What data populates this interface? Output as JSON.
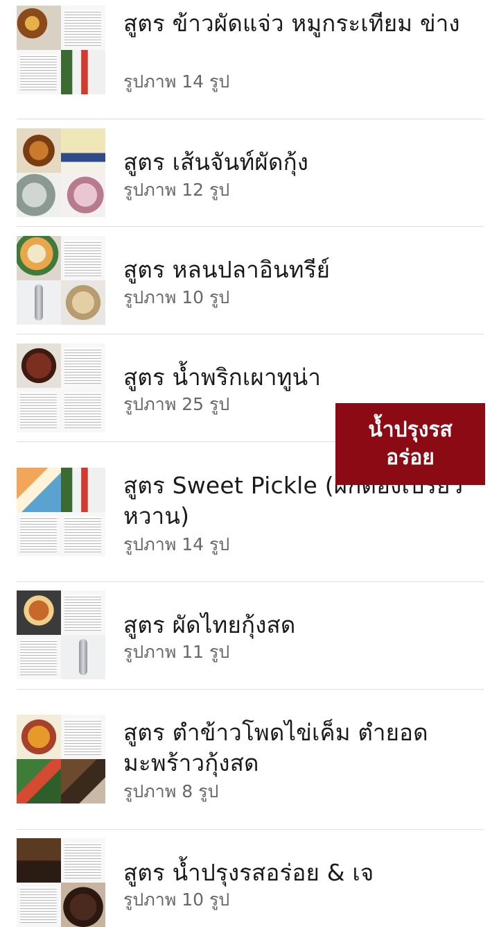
{
  "albums": [
    {
      "title": "สูตร ข้าวผัดแจ่ว หมูกระเทียม ข่าง",
      "count": "รูปภาพ 14 รูป"
    },
    {
      "title": "สูตร เส้นจันท์ผัดกุ้ง",
      "count": "รูปภาพ 12 รูป"
    },
    {
      "title": "สูตร หลนปลาอินทรีย์",
      "count": "รูปภาพ 10 รูป"
    },
    {
      "title": "สูตร น้ำพริกเผาทูน่า",
      "count": "รูปภาพ 25 รูป"
    },
    {
      "title": "สูตร Sweet Pickle (ผักดองเปรี้ยวหวาน)",
      "count": "รูปภาพ 14 รูป"
    },
    {
      "title": "สูตร ผัดไทยกุ้งสด",
      "count": "รูปภาพ 11 รูป"
    },
    {
      "title": "สูตร ตำข้าวโพดไข่เค็ม ตำยอดมะพร้าวกุ้งสด",
      "count": "รูปภาพ 8 รูป"
    },
    {
      "title": "สูตร น้ำปรุงรสอร่อย & เจ",
      "count": "รูปภาพ 10 รูป"
    }
  ],
  "overlay": {
    "text": "น้ำปรุงรส อร่อย"
  },
  "colors": {
    "overlay_bg": "#8b0a13",
    "count_text": "#65676b",
    "divider": "#dadde1"
  }
}
